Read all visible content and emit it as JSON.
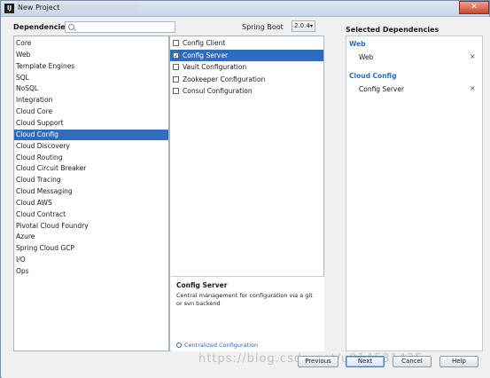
{
  "window": {
    "title": "New Project"
  },
  "dependencies_label": "Dependencies",
  "search": {
    "placeholder": ""
  },
  "spring_boot": {
    "label": "Spring Boot",
    "version": "2.0.4"
  },
  "categories": [
    {
      "label": "Core",
      "selected": false
    },
    {
      "label": "Web",
      "selected": false
    },
    {
      "label": "Template Engines",
      "selected": false
    },
    {
      "label": "SQL",
      "selected": false
    },
    {
      "label": "NoSQL",
      "selected": false
    },
    {
      "label": "Integration",
      "selected": false
    },
    {
      "label": "Cloud Core",
      "selected": false
    },
    {
      "label": "Cloud Support",
      "selected": false
    },
    {
      "label": "Cloud Config",
      "selected": true
    },
    {
      "label": "Cloud Discovery",
      "selected": false
    },
    {
      "label": "Cloud Routing",
      "selected": false
    },
    {
      "label": "Cloud Circuit Breaker",
      "selected": false
    },
    {
      "label": "Cloud Tracing",
      "selected": false
    },
    {
      "label": "Cloud Messaging",
      "selected": false
    },
    {
      "label": "Cloud AWS",
      "selected": false
    },
    {
      "label": "Cloud Contract",
      "selected": false
    },
    {
      "label": "Pivotal Cloud Foundry",
      "selected": false
    },
    {
      "label": "Azure",
      "selected": false
    },
    {
      "label": "Spring Cloud GCP",
      "selected": false
    },
    {
      "label": "I/O",
      "selected": false
    },
    {
      "label": "Ops",
      "selected": false
    }
  ],
  "dependencies": [
    {
      "label": "Config Client",
      "checked": false,
      "selected": false
    },
    {
      "label": "Config Server",
      "checked": true,
      "selected": true
    },
    {
      "label": "Vault Configuration",
      "checked": false,
      "selected": false
    },
    {
      "label": "Zookeeper Configuration",
      "checked": false,
      "selected": false
    },
    {
      "label": "Consul Configuration",
      "checked": false,
      "selected": false
    }
  ],
  "description": {
    "title": "Config Server",
    "text": "Central management for configuration via a git or svn backend",
    "link": "Centralized Configuration"
  },
  "selected_dependencies": {
    "title": "Selected Dependencies",
    "groups": [
      {
        "name": "Web",
        "items": [
          "Web"
        ]
      },
      {
        "name": "Cloud Config",
        "items": [
          "Config Server"
        ]
      }
    ]
  },
  "watermark": "https://blog.csdn.net/u014531425",
  "buttons": {
    "previous": "Previous",
    "next": "Next",
    "cancel": "Cancel",
    "help": "Help"
  }
}
